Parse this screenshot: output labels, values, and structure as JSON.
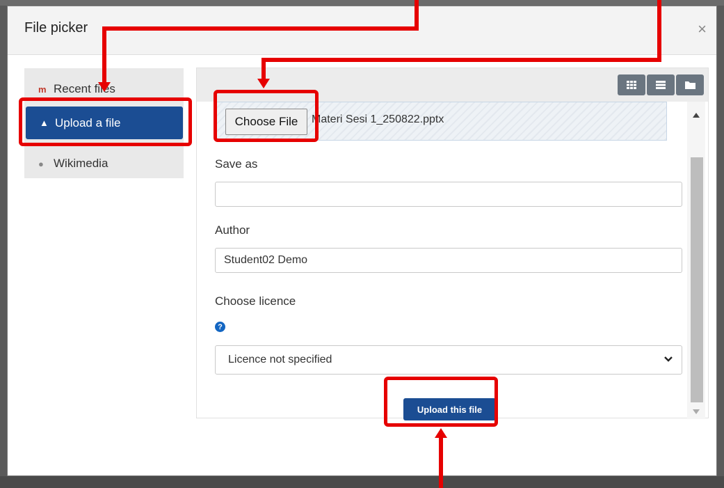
{
  "dialog": {
    "title": "File picker",
    "close_icon": "×"
  },
  "nav": {
    "items": [
      {
        "label": "Recent files",
        "icon": "recent-files-icon",
        "active": false
      },
      {
        "label": "Upload a file",
        "icon": "upload-icon",
        "active": true
      },
      {
        "label": "Wikimedia",
        "icon": "wikimedia-icon",
        "active": false
      }
    ]
  },
  "toolbar": {
    "view_icons": [
      "grid-view-icon",
      "list-view-icon",
      "folder-view-icon"
    ]
  },
  "form": {
    "choose_file_label": "Choose File",
    "selected_file_name": "Materi Sesi 1_250822.pptx",
    "save_as_label": "Save as",
    "save_as_value": "",
    "author_label": "Author",
    "author_value": "Student02 Demo",
    "licence_label": "Choose licence",
    "licence_value": "Licence not specified",
    "upload_button_label": "Upload this file"
  },
  "colors": {
    "accent": "#1b4d93",
    "annotation": "#e60000"
  }
}
